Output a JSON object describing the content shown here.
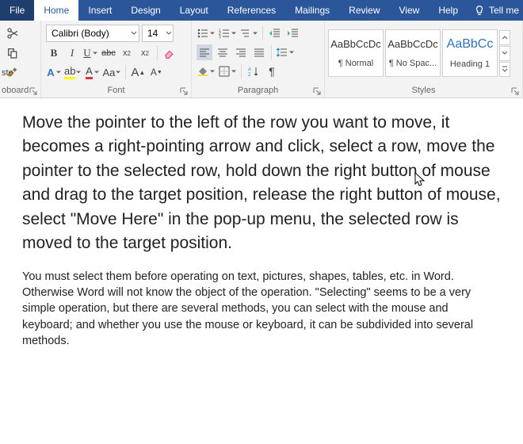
{
  "tabs": {
    "file": "File",
    "home": "Home",
    "insert": "Insert",
    "design": "Design",
    "layout": "Layout",
    "references": "References",
    "mailings": "Mailings",
    "review": "Review",
    "view": "View",
    "help": "Help",
    "tellme": "Tell me"
  },
  "clipboard": {
    "label": "oboard"
  },
  "font": {
    "name": "Calibri (Body)",
    "size": "14",
    "label": "Font",
    "bold": "B",
    "italic": "I",
    "underline": "U",
    "strike": "abc",
    "sub": "x",
    "sup": "x",
    "grow": "A",
    "shrink": "A",
    "caseA": "Aa",
    "fontcolorA": "A",
    "highlight": "ab",
    "effectsA": "A"
  },
  "paragraph": {
    "label": "Paragraph",
    "pilcrow": "¶"
  },
  "styles": {
    "label": "Styles",
    "preview": "AaBbCcDc",
    "preview_h1": "AaBbCc",
    "items": [
      {
        "name": "¶ Normal"
      },
      {
        "name": "¶ No Spac..."
      },
      {
        "name": "Heading 1"
      }
    ]
  },
  "ste_label": "ste",
  "document": {
    "p1": "Move the pointer to the left of the row you want to move, it becomes a right-pointing arrow and click, select a row, move the pointer to the selected row, hold down the right button of mouse and drag to the target position, release the right button of mouse, select \"Move Here\" in the pop-up menu, the selected row is moved to the target position.",
    "p2": "You must select them before operating on text, pictures, shapes, tables, etc. in Word. Otherwise Word will not know the object of the operation. \"Selecting\" seems to be a very simple operation, but there are several methods, you can select with the mouse and keyboard; and whether you use the mouse or keyboard, it can be subdivided into several methods."
  }
}
